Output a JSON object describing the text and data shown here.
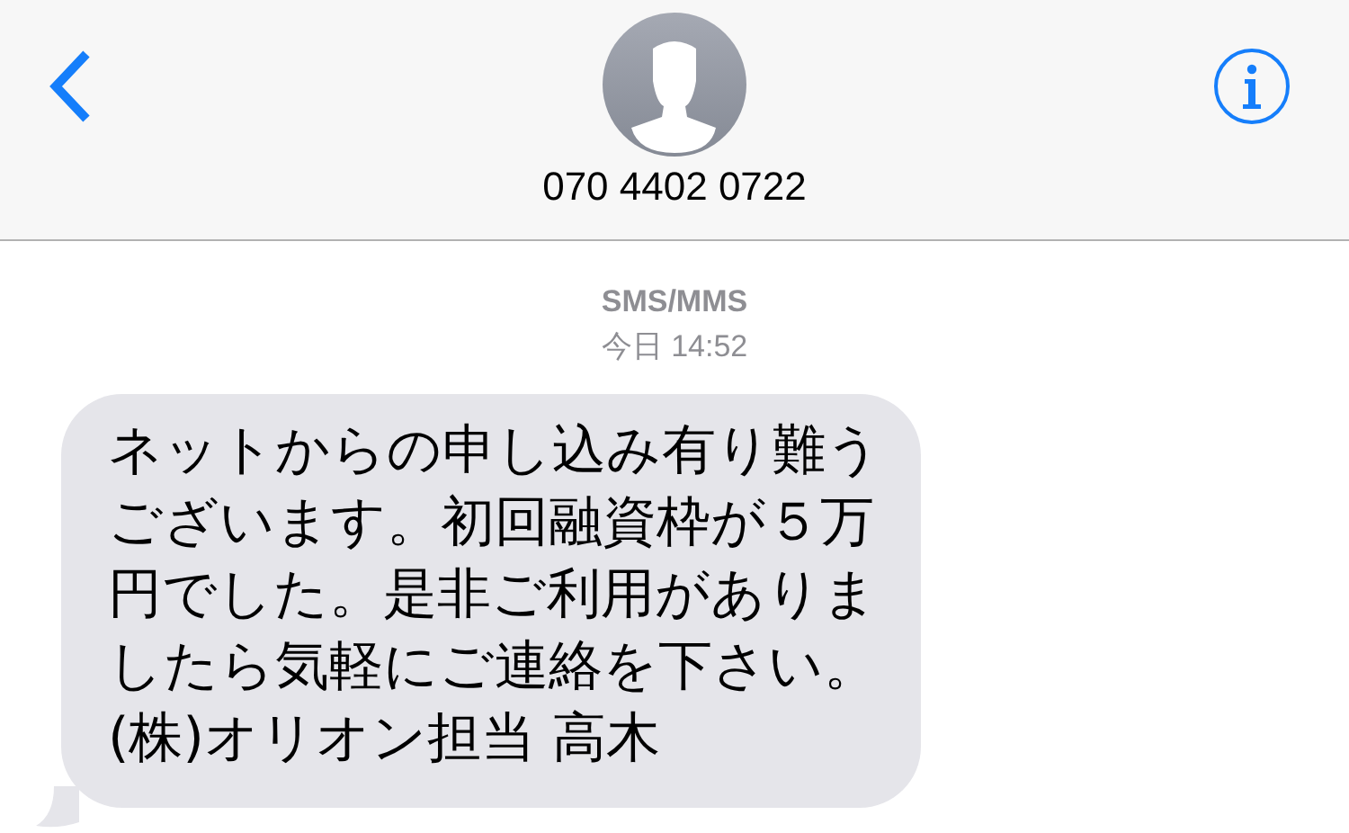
{
  "header": {
    "contact_name": "070 4402 0722"
  },
  "timestamp": {
    "service": "SMS/MMS",
    "time": "今日 14:52"
  },
  "messages": [
    {
      "kind": "incoming",
      "text": "ネットからの申し込み有り難うございます。初回融資枠が５万円でした。是非ご利用がありましたら気軽にご連絡を下さい。(株)オリオン担当 高木"
    }
  ]
}
